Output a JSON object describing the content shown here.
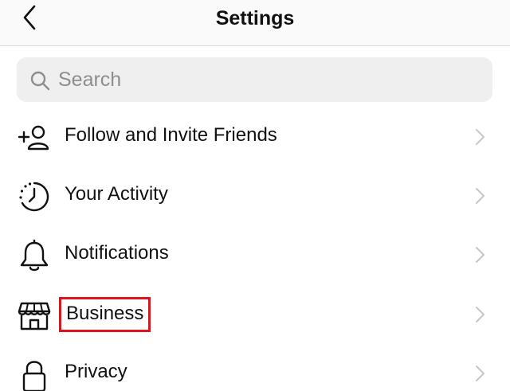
{
  "header": {
    "title": "Settings",
    "back_icon": "chevron-left-icon"
  },
  "search": {
    "placeholder": "Search",
    "value": "",
    "icon": "search-icon"
  },
  "menu": {
    "items": [
      {
        "label": "Follow and Invite Friends",
        "icon": "add-person-icon"
      },
      {
        "label": "Your Activity",
        "icon": "activity-clock-icon"
      },
      {
        "label": "Notifications",
        "icon": "bell-icon"
      },
      {
        "label": "Business",
        "icon": "storefront-icon",
        "highlighted": true
      },
      {
        "label": "Privacy",
        "icon": "lock-icon"
      }
    ]
  },
  "colors": {
    "highlight_border": "#e0121c",
    "chevron": "#c7c7c7",
    "search_bg": "#efefef",
    "placeholder": "#8e8e8e"
  }
}
